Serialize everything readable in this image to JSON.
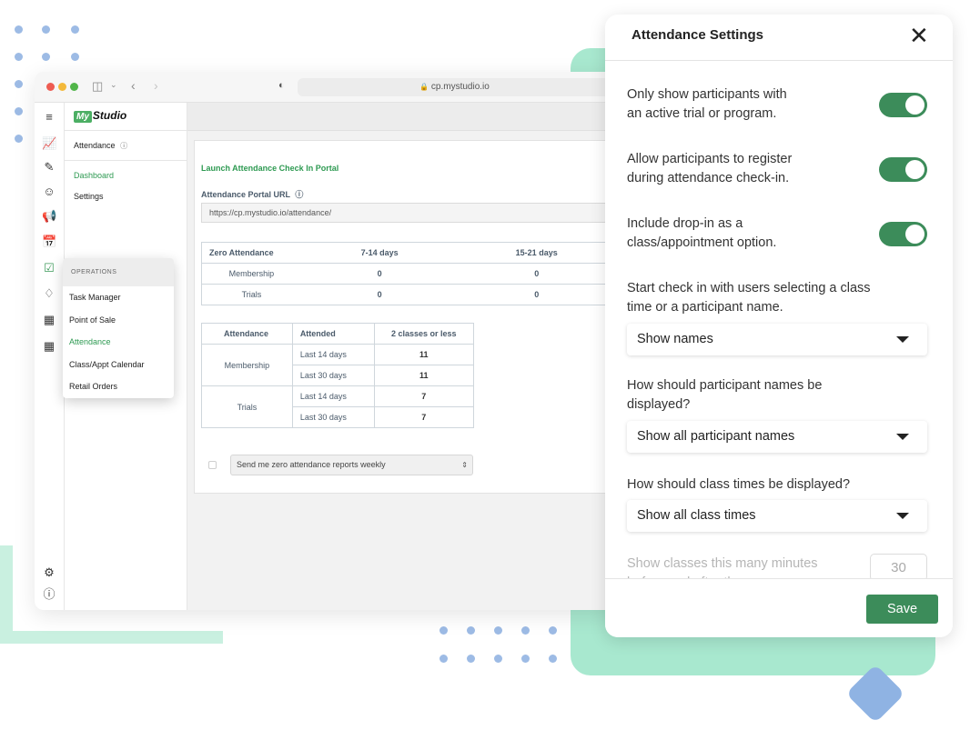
{
  "browser": {
    "url": "cp.mystudio.io"
  },
  "app": {
    "logo_prefix": "My",
    "logo_text": "Studio"
  },
  "nav": {
    "section": "Attendance",
    "dashboard": "Dashboard",
    "settings": "Settings"
  },
  "content": {
    "launch_link": "Launch Attendance Check In Portal",
    "portal_label": "Attendance Portal URL",
    "portal_url": "https://cp.mystudio.io/attendance/",
    "zero_table": {
      "headers": [
        "Zero Attendance",
        "7-14 days",
        "15-21 days"
      ],
      "rows": [
        [
          "Membership",
          "0",
          "0"
        ],
        [
          "Trials",
          "0",
          "0"
        ]
      ]
    },
    "att_table": {
      "headers": [
        "Attendance",
        "Attended",
        "2 classes or less"
      ],
      "groups": [
        {
          "name": "Membership",
          "rows": [
            [
              "Last 14 days",
              "11"
            ],
            [
              "Last 30 days",
              "11"
            ]
          ]
        },
        {
          "name": "Trials",
          "rows": [
            [
              "Last 14 days",
              "7"
            ],
            [
              "Last 30 days",
              "7"
            ]
          ]
        }
      ]
    },
    "report_select": "Send me zero attendance reports weekly"
  },
  "operations_menu": {
    "heading": "OPERATIONS",
    "items": [
      "Task Manager",
      "Point of Sale",
      "Attendance",
      "Class/Appt Calendar",
      "Retail Orders"
    ],
    "active_item": "Attendance"
  },
  "settings_panel": {
    "title": "Attendance Settings",
    "toggles": [
      {
        "label_line1": "Only show participants with",
        "label_line2": "an active trial or program.",
        "on": true
      },
      {
        "label_line1": "Allow participants to register",
        "label_line2": "during attendance check-in.",
        "on": true
      },
      {
        "label_line1": "Include drop-in as a",
        "label_line2": "class/appointment option.",
        "on": true
      }
    ],
    "start_checkin": {
      "label_line1": "Start check in with users selecting a class",
      "label_line2": "time or a participant name.",
      "value": "Show names"
    },
    "name_display": {
      "label_line1": "How should participant names be",
      "label_line2": "displayed?",
      "value": "Show all participant names"
    },
    "class_times": {
      "label": "How should class times be displayed?",
      "value": "Show all class times"
    },
    "classes_window": {
      "label": "Show classes this many minutes before and after the",
      "value": "30"
    },
    "save_label": "Save"
  },
  "colors": {
    "accent_green": "#3c8c5a",
    "link_green": "#2e9a52",
    "mint": "#a8e8cf",
    "dot_blue": "#9dbbe5"
  }
}
